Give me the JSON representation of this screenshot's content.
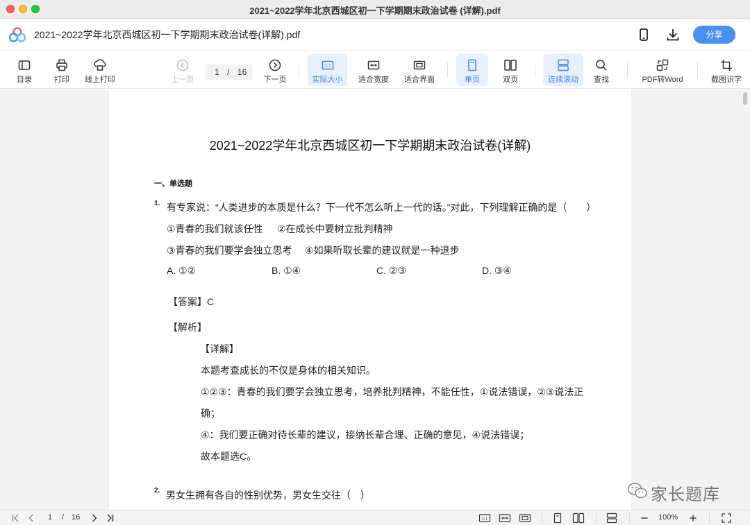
{
  "window": {
    "title": "2021~2022学年北京西城区初一下学期期末政治试卷 (详解).pdf"
  },
  "header": {
    "doc_title": "2021~2022学年北京西城区初一下学期期末政治试卷(详解).pdf",
    "share_label": "分享",
    "icons": [
      "app-logo-icon",
      "phone-icon",
      "download-icon"
    ]
  },
  "toolbar": {
    "toc": "目录",
    "print": "打印",
    "online_print": "线上打印",
    "prev_page": "上一页",
    "current_page": "1",
    "page_sep": "/",
    "total_pages": "16",
    "next_page": "下一页",
    "actual_size": "实际大小",
    "fit_width": "适合宽度",
    "fit_page": "适合界面",
    "single_page": "单页",
    "double_page": "双页",
    "continuous_scroll": "连续滚动",
    "find": "查找",
    "pdf_to_word": "PDF转Word",
    "ocr": "截图识字",
    "accent_color": "#3b82f6",
    "active_bg": "#e7f0fd"
  },
  "document": {
    "title": "2021~2022学年北京西城区初一下学期期末政治试卷(详解)",
    "section": "一、单选题",
    "q1": {
      "number": "1.",
      "stem": "有专家说：“人类进步的本质是什么？下一代不怎么听上一代的话。”对此，下列理解正确的是（　　）",
      "statement_1": "①青春的我们就该任性",
      "statement_2": "②在成长中要树立批判精神",
      "statement_3": "③青春的我们要学会独立思考",
      "statement_4": "④如果听取长辈的建议就是一种退步",
      "option_a": "A. ①②",
      "option_b": "B. ①④",
      "option_c": "C. ②③",
      "option_d": "D. ③④",
      "answer": "【答案】C",
      "analysis_label": "【解析】",
      "detail_label": "【详解】",
      "detail_1": "本题考查成长的不仅是身体的相关知识。",
      "detail_2": "①②③：青春的我们要学会独立思考，培养批判精神，不能任性，①说法错误，②③说法正",
      "detail_3": "确；",
      "detail_4": "④：我们要正确对待长辈的建议，接纳长辈合理、正确的意见，④说法错误；",
      "detail_5": "故本题选C。"
    },
    "q2": {
      "number": "2.",
      "stem": "男女生拥有各自的性别优势，男女生交往（　）"
    }
  },
  "watermark": {
    "text": "家长题库"
  },
  "statusbar": {
    "current_page": "1",
    "page_sep": "/",
    "total_pages": "16",
    "zoom": "100%"
  }
}
